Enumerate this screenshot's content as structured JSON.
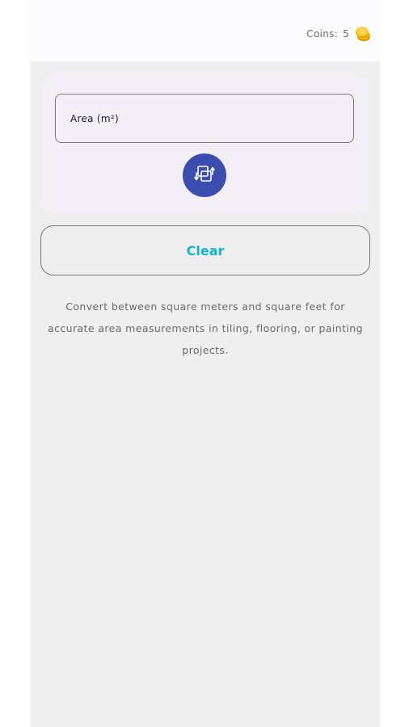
{
  "header": {
    "coins_label": "Coins:",
    "coins_count": "5",
    "coin_icon": "coin-stack-icon"
  },
  "converter": {
    "area_field_label": "Area (m²)",
    "swap_icon": "swap-units-icon"
  },
  "actions": {
    "clear_label": "Clear"
  },
  "description": "Convert between square meters and square feet for accurate area measurements in tiling, flooring, or painting projects.",
  "colors": {
    "accent": "#10b4cc",
    "swap_button": "#3b4eb0",
    "coin": "#f4b400"
  }
}
